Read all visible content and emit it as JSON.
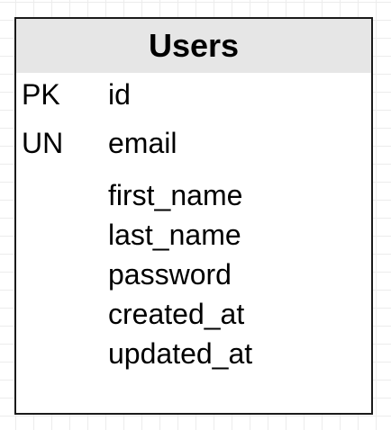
{
  "entity": {
    "title": "Users",
    "key_rows": [
      {
        "key": "PK",
        "field": "id"
      },
      {
        "key": "UN",
        "field": "email"
      }
    ],
    "fields": [
      "first_name",
      "last_name",
      "password",
      "created_at",
      "updated_at"
    ]
  },
  "colors": {
    "header_bg": "#e6e6e6",
    "border": "#1a1a1a",
    "grid": "#ececec"
  }
}
